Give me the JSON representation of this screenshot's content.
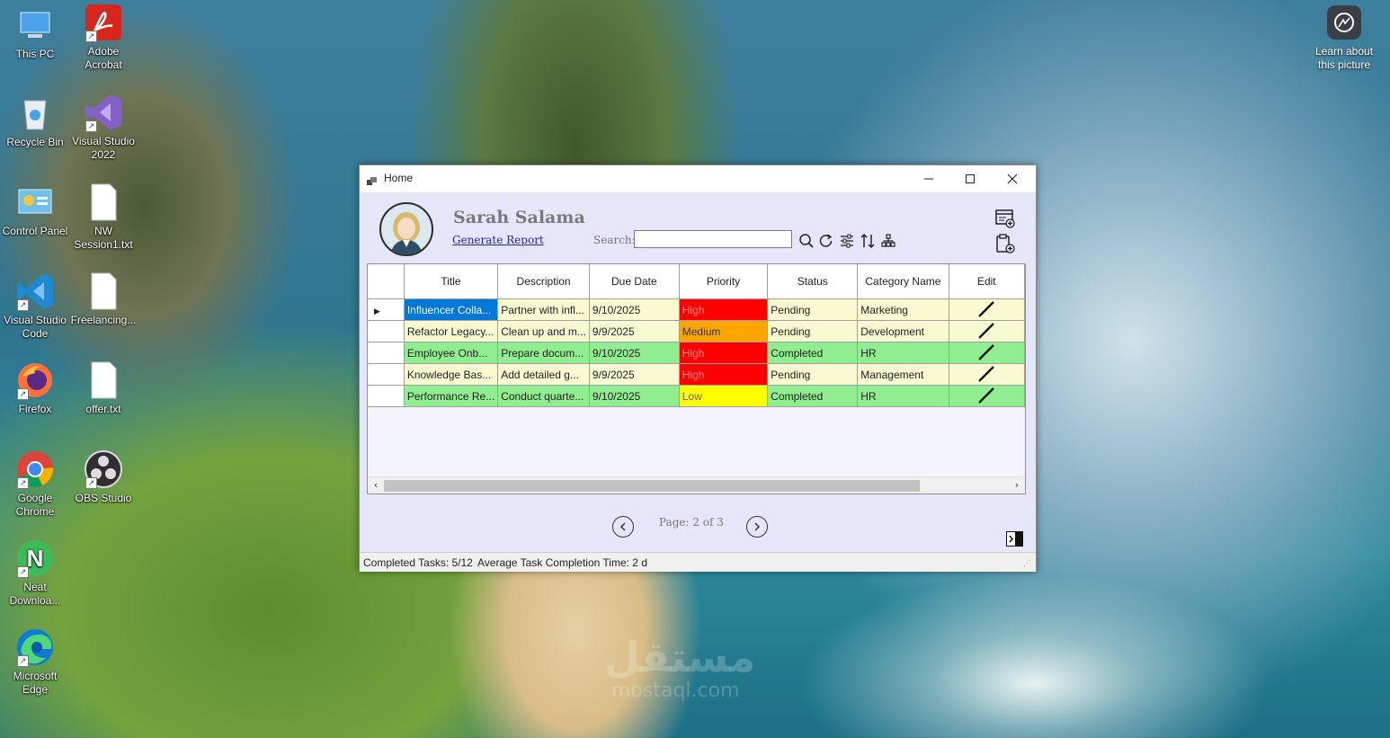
{
  "desktop": {
    "icons": [
      {
        "label": "This PC",
        "icon": "this-pc-icon"
      },
      {
        "label": "Adobe Acrobat",
        "icon": "adobe-acrobat-icon"
      },
      {
        "label": "Recycle Bin",
        "icon": "recycle-bin-icon"
      },
      {
        "label": "Visual Studio 2022",
        "icon": "visual-studio-icon"
      },
      {
        "label": "Control Panel",
        "icon": "control-panel-icon"
      },
      {
        "label": "NW Session1.txt",
        "icon": "text-file-icon"
      },
      {
        "label": "Visual Studio Code",
        "icon": "vscode-icon"
      },
      {
        "label": "Freelancing...",
        "icon": "text-file-icon"
      },
      {
        "label": "Firefox",
        "icon": "firefox-icon"
      },
      {
        "label": "offer.txt",
        "icon": "text-file-icon"
      },
      {
        "label": "Google Chrome",
        "icon": "chrome-icon"
      },
      {
        "label": "OBS Studio",
        "icon": "obs-icon"
      },
      {
        "label": "Neat Downloa...",
        "icon": "neat-download-icon"
      },
      {
        "label": "Microsoft Edge",
        "icon": "edge-icon"
      }
    ],
    "learn_about_picture": "Learn about this picture",
    "watermark_ar": "مستقل",
    "watermark_en": "mostaql.com"
  },
  "window": {
    "title": "Home",
    "controls": {
      "minimize": "—",
      "maximize": "☐",
      "close": "✕"
    },
    "user_name": "Sarah Salama",
    "generate_report": "Generate Report",
    "search_label": "Search:",
    "search_value": "",
    "toolbar_icons": [
      "search-icon",
      "refresh-icon",
      "filter-icon",
      "sort-icon",
      "hierarchy-icon"
    ],
    "right_icons": [
      "add-task-icon",
      "add-category-icon"
    ],
    "grid": {
      "columns": [
        "Title",
        "Description",
        "Due Date",
        "Priority",
        "Status",
        "Category Name",
        "Edit"
      ],
      "rows": [
        {
          "title": "Influencer Colla...",
          "description": "Partner with infl...",
          "due_date": "9/10/2025",
          "priority": "High",
          "status": "Pending",
          "category": "Marketing",
          "selected": true
        },
        {
          "title": "Refactor Legacy...",
          "description": "Clean up and m...",
          "due_date": "9/9/2025",
          "priority": "Medium",
          "status": "Pending",
          "category": "Development"
        },
        {
          "title": "Employee Onb...",
          "description": "Prepare docum...",
          "due_date": "9/10/2025",
          "priority": "High",
          "status": "Completed",
          "category": "HR"
        },
        {
          "title": "Knowledge Bas...",
          "description": "Add detailed g...",
          "due_date": "9/9/2025",
          "priority": "High",
          "status": "Pending",
          "category": "Management"
        },
        {
          "title": "Performance Re...",
          "description": "Conduct quarte...",
          "due_date": "9/10/2025",
          "priority": "Low",
          "status": "Completed",
          "category": "HR"
        }
      ]
    },
    "page_text": "Page: 2 of 3",
    "status_completed": "Completed Tasks: 5/12",
    "status_avg": "Average Task Completion Time: 2 d"
  },
  "colors": {
    "window_bg": "#e6e6fa",
    "pending_row": "#fafad2",
    "completed_row": "#90ee90",
    "selected_cell": "#0078d7",
    "priority_high": "#ff0000",
    "priority_medium": "#ffa500",
    "priority_low": "#ffff00"
  }
}
